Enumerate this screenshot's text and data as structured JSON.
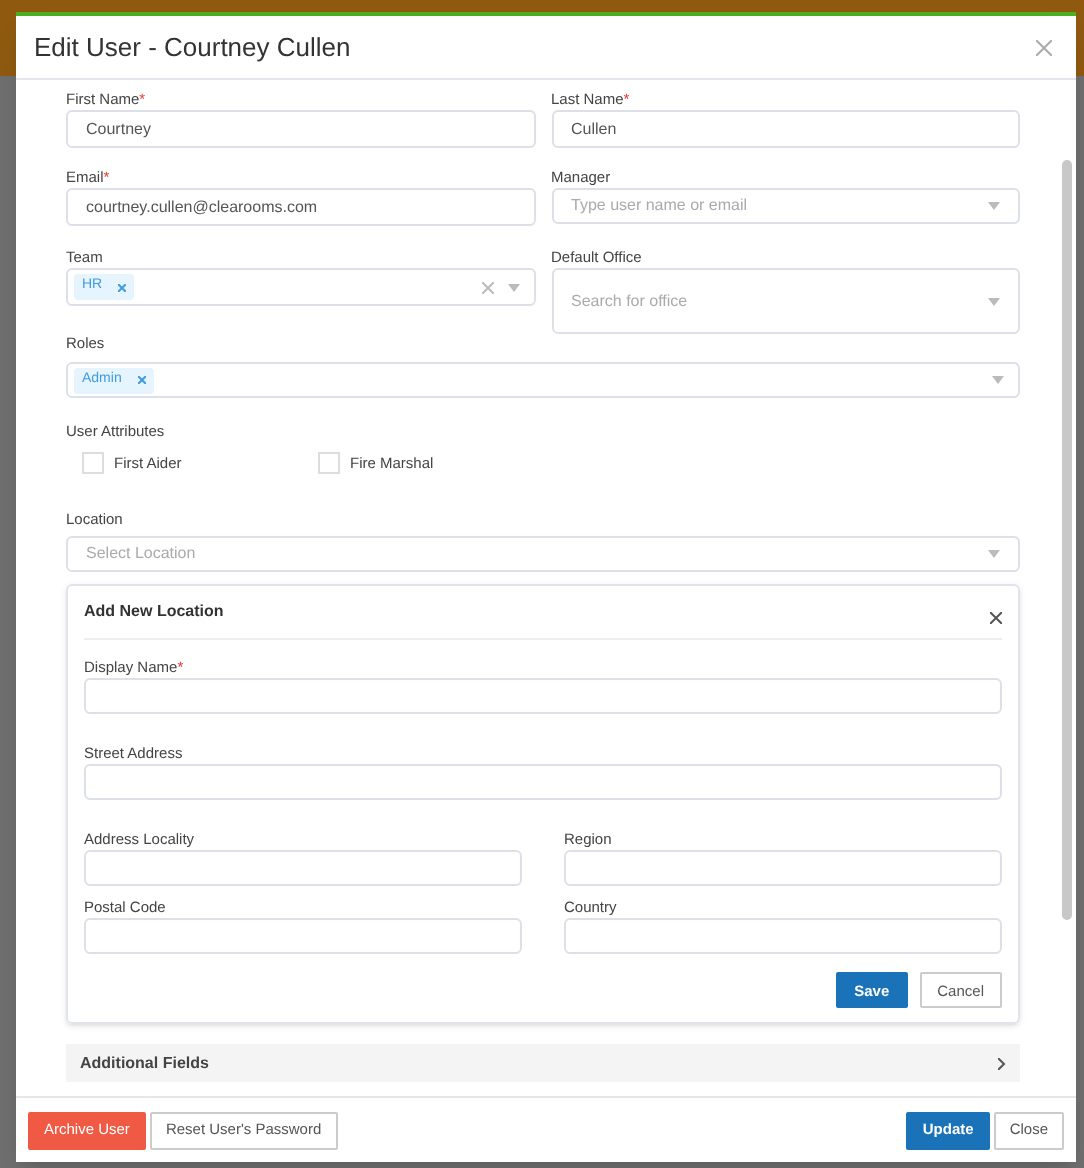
{
  "modal": {
    "title": "Edit User - Courtney Cullen"
  },
  "first_name": {
    "label": "First Name",
    "required_mark": "*",
    "value": "Courtney"
  },
  "last_name": {
    "label": "Last Name",
    "required_mark": "*",
    "value": "Cullen"
  },
  "email": {
    "label": "Email",
    "required_mark": "*",
    "value": "courtney.cullen@clearooms.com"
  },
  "manager": {
    "label": "Manager",
    "placeholder": "Type user name or email"
  },
  "team": {
    "label": "Team",
    "tags": [
      "HR"
    ],
    "clearable": true
  },
  "default_office": {
    "label": "Default Office",
    "placeholder": "Search for office"
  },
  "roles": {
    "label": "Roles",
    "tags": [
      "Admin"
    ]
  },
  "user_attributes": {
    "label": "User Attributes",
    "options": [
      {
        "label": "First Aider",
        "checked": false
      },
      {
        "label": "Fire Marshal",
        "checked": false
      }
    ]
  },
  "location": {
    "label": "Location",
    "placeholder": "Select Location"
  },
  "add_location": {
    "title": "Add New Location",
    "display_name": {
      "label": "Display Name",
      "required_mark": "*"
    },
    "street_address": {
      "label": "Street Address"
    },
    "grid": [
      {
        "label": "Address Locality"
      },
      {
        "label": "Region"
      },
      {
        "label": "Postal Code"
      },
      {
        "label": "Country"
      }
    ],
    "buttons": [
      {
        "label": "Save",
        "kind": "primary"
      },
      {
        "label": "Cancel",
        "kind": "default"
      }
    ]
  },
  "additional_fields": {
    "label": "Additional Fields",
    "expanded": false
  },
  "footer": {
    "left": [
      {
        "label": "Archive User",
        "kind": "danger"
      },
      {
        "label": "Reset User's Password",
        "kind": "default"
      }
    ],
    "right": [
      {
        "label": "Update",
        "kind": "primary"
      },
      {
        "label": "Close",
        "kind": "default"
      }
    ]
  }
}
